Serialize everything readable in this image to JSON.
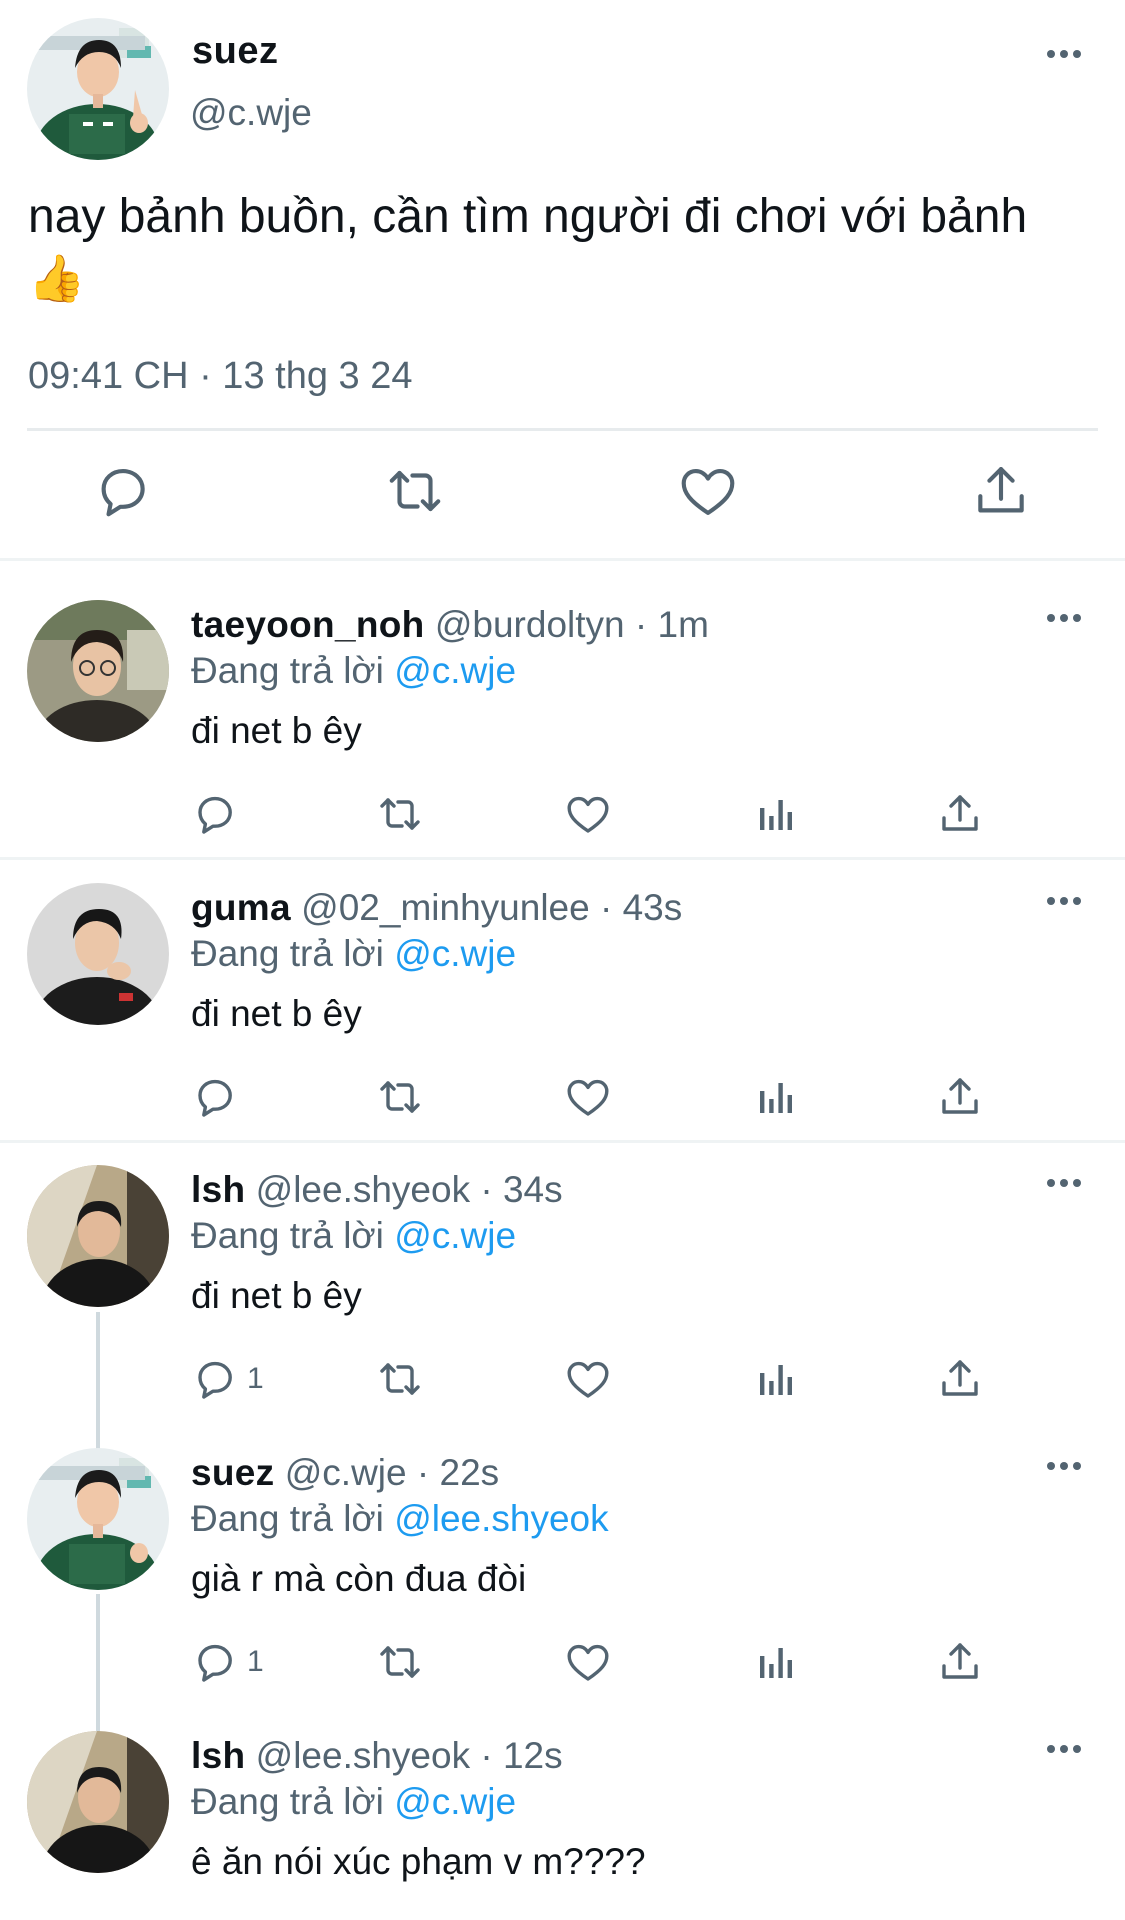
{
  "main_tweet": {
    "display_name": "suez",
    "handle": "@c.wje",
    "text": "nay bảnh buồn, cần tìm người đi chơi với bảnh",
    "emoji": "👍",
    "meta": "09:41 CH · 13 thg 3 24",
    "actions": [
      "reply-icon",
      "retweet-icon",
      "like-icon",
      "share-icon"
    ]
  },
  "replies": [
    {
      "display_name": "taeyoon_noh",
      "handle": "@burdoltyn",
      "time": "· 1m",
      "replying_prefix": "Đang trả lời",
      "mention": "@c.wje",
      "text": "đi net b êy",
      "reply_count": ""
    },
    {
      "display_name": "guma",
      "handle": "@02_minhyunlee",
      "time": "· 43s",
      "replying_prefix": "Đang trả lời",
      "mention": "@c.wje",
      "text": "đi net b êy",
      "reply_count": ""
    },
    {
      "display_name": "lsh",
      "handle": "@lee.shyeok",
      "time": "· 34s",
      "replying_prefix": "Đang trả lời",
      "mention": "@c.wje",
      "text": "đi net b êy",
      "reply_count": "1"
    },
    {
      "display_name": "suez",
      "handle": "@c.wje",
      "time": "· 22s",
      "replying_prefix": "Đang trả lời",
      "mention": "@lee.shyeok",
      "text": "già r mà còn đua đòi",
      "reply_count": "1"
    },
    {
      "display_name": "lsh",
      "handle": "@lee.shyeok",
      "time": "· 12s",
      "replying_prefix": "Đang trả lời",
      "mention": "@c.wje",
      "text": "ê ăn nói xúc phạm v m????",
      "reply_count": ""
    }
  ],
  "colors": {
    "accent": "#1d9bf0",
    "secondary_text": "#536471",
    "primary_text": "#0f1419",
    "divider": "#eff3f4"
  }
}
